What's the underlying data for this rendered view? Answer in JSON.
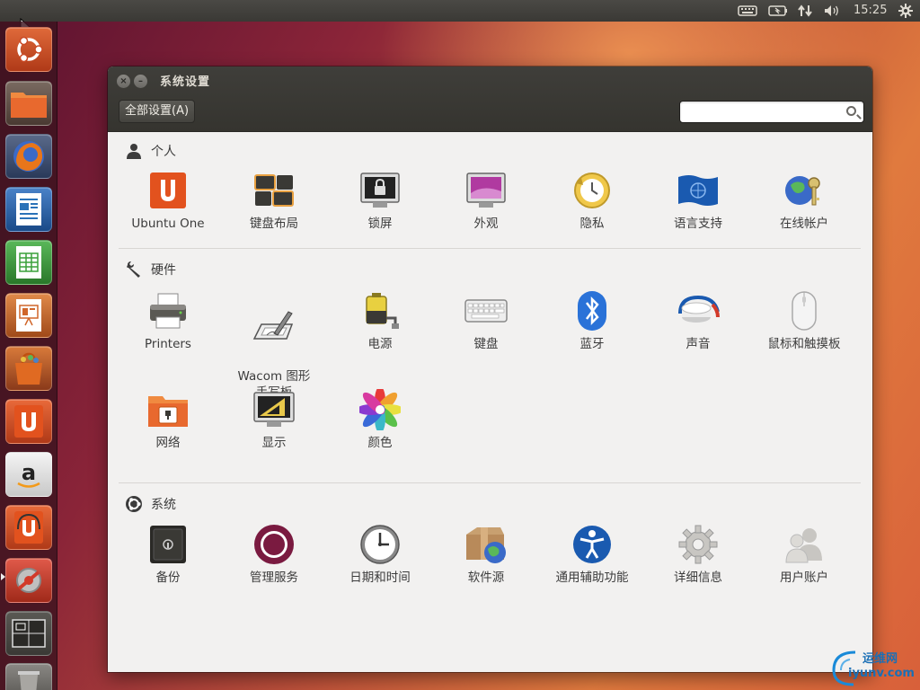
{
  "topbar": {
    "tray_icons": [
      "keyboard-icon",
      "battery-icon",
      "network-icon",
      "volume-icon"
    ],
    "clock": "15:25",
    "settings_icon": "gear-icon"
  },
  "launcher": {
    "items": [
      {
        "name": "dash-home",
        "icon": "ubuntu-logo-icon",
        "color": "#c94a25"
      },
      {
        "name": "files",
        "icon": "folder-icon",
        "color": "#e8692e"
      },
      {
        "name": "firefox",
        "icon": "firefox-icon",
        "color": "#e55b1d"
      },
      {
        "name": "libreoffice-writer",
        "icon": "writer-icon",
        "color": "#2a72b8"
      },
      {
        "name": "libreoffice-calc",
        "icon": "calc-icon",
        "color": "#3aa03a"
      },
      {
        "name": "libreoffice-impress",
        "icon": "impress-icon",
        "color": "#d0662a"
      },
      {
        "name": "software-center",
        "icon": "shopping-bag-icon",
        "color": "#e06a22"
      },
      {
        "name": "ubuntu-one",
        "icon": "ubuntu-one-icon",
        "color": "#e2521e"
      },
      {
        "name": "amazon",
        "icon": "amazon-icon",
        "color": "#f4f4f4"
      },
      {
        "name": "ubuntu-one-music",
        "icon": "music-store-icon",
        "color": "#e2521e"
      },
      {
        "name": "system-settings",
        "icon": "settings-tools-icon",
        "color": "#d23a2a"
      },
      {
        "name": "workspace-switcher",
        "icon": "workspace-icon",
        "color": "#3a3935"
      },
      {
        "name": "trash",
        "icon": "trash-icon",
        "color": "#7a7874"
      }
    ]
  },
  "window": {
    "title": "系统设置",
    "all_settings_button": "全部设置(A)",
    "search_placeholder": ""
  },
  "sections": [
    {
      "title": "个人",
      "icon": "person-icon",
      "items": [
        {
          "label": "Ubuntu One",
          "icon": "ubuntu-one-icon"
        },
        {
          "label": "键盘布局",
          "icon": "keyboard-layout-icon"
        },
        {
          "label": "锁屏",
          "icon": "lock-screen-icon"
        },
        {
          "label": "外观",
          "icon": "appearance-icon"
        },
        {
          "label": "隐私",
          "icon": "privacy-icon"
        },
        {
          "label": "语言支持",
          "icon": "language-flag-icon"
        },
        {
          "label": "在线帐户",
          "icon": "online-accounts-icon"
        }
      ]
    },
    {
      "title": "硬件",
      "icon": "wrench-icon",
      "items": [
        {
          "label": "Printers",
          "icon": "printer-icon"
        },
        {
          "label": "Wacom 图形\n手写板",
          "icon": "wacom-tablet-icon"
        },
        {
          "label": "电源",
          "icon": "power-battery-icon"
        },
        {
          "label": "键盘",
          "icon": "keyboard-icon"
        },
        {
          "label": "蓝牙",
          "icon": "bluetooth-icon"
        },
        {
          "label": "声音",
          "icon": "sound-knob-icon"
        },
        {
          "label": "鼠标和触摸板",
          "icon": "mouse-icon"
        },
        {
          "label": "网络",
          "icon": "network-folder-icon"
        },
        {
          "label": "显示",
          "icon": "display-icon"
        },
        {
          "label": "颜色",
          "icon": "color-wheel-icon"
        }
      ]
    },
    {
      "title": "系统",
      "icon": "ubuntu-system-icon",
      "items": [
        {
          "label": "备份",
          "icon": "backup-safe-icon"
        },
        {
          "label": "管理服务",
          "icon": "landscape-icon"
        },
        {
          "label": "日期和时间",
          "icon": "clock-icon"
        },
        {
          "label": "软件源",
          "icon": "software-sources-icon"
        },
        {
          "label": "通用辅助功能",
          "icon": "accessibility-icon"
        },
        {
          "label": "详细信息",
          "icon": "details-gear-icon"
        },
        {
          "label": "用户账户",
          "icon": "user-accounts-icon"
        }
      ]
    }
  ],
  "watermark": {
    "line1": "运维网",
    "line2": "iyunv.com"
  }
}
